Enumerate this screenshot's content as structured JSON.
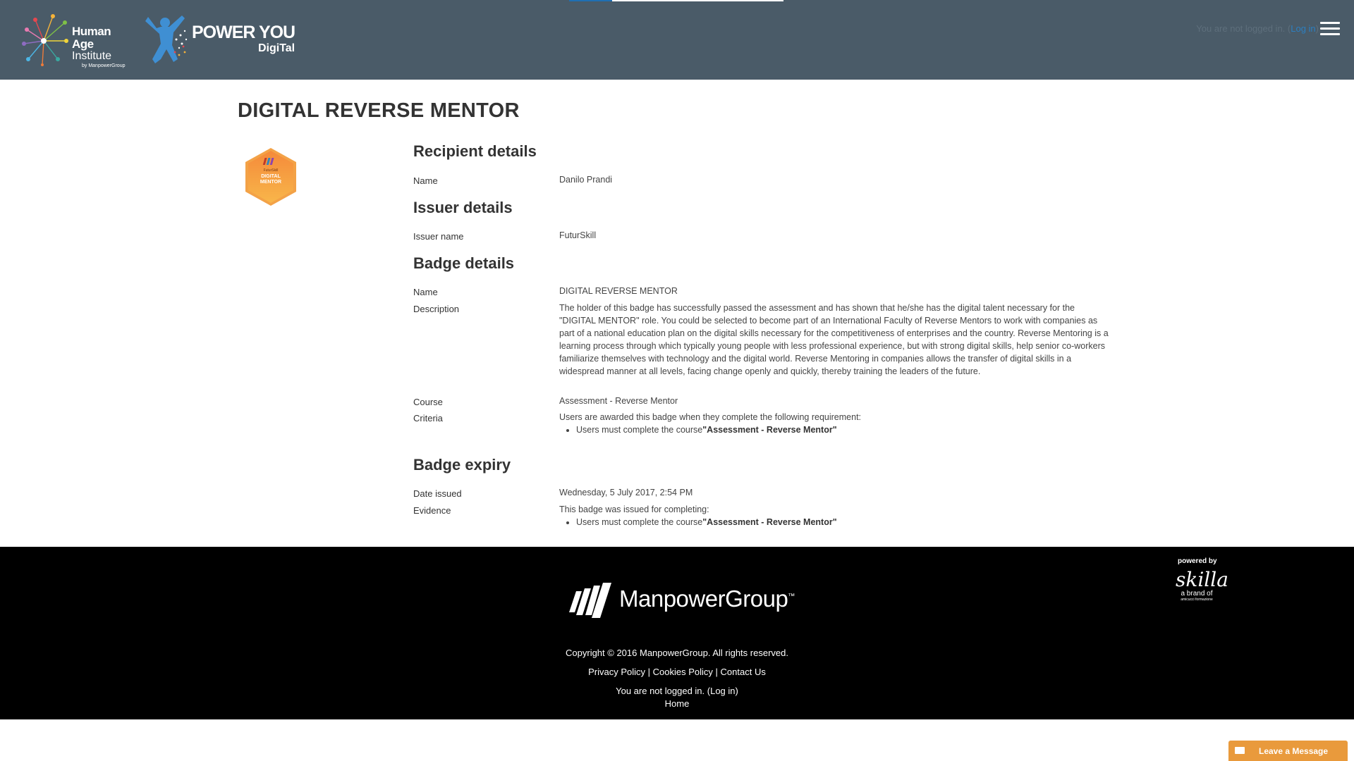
{
  "header": {
    "logo_hai": {
      "line1": "Human Age",
      "line2": "Institute",
      "line3": "by ManpowerGroup"
    },
    "logo_py": {
      "line1": "POWER YOU",
      "line2": "DigiTal"
    },
    "login_status_prefix": "You are not logged in. (",
    "login_link": "Log in",
    "login_status_suffix": ")",
    "top_progress_percent": 20
  },
  "page": {
    "title": "DIGITAL REVERSE MENTOR"
  },
  "badge_image": {
    "line1": "FuturSkill",
    "line2": "DIGITAL",
    "line3": "MENTOR"
  },
  "recipient": {
    "heading": "Recipient details",
    "name_label": "Name",
    "name_value": "Danilo Prandi"
  },
  "issuer": {
    "heading": "Issuer details",
    "name_label": "Issuer name",
    "name_value": "FuturSkill"
  },
  "badge": {
    "heading": "Badge details",
    "name_label": "Name",
    "name_value": "DIGITAL REVERSE MENTOR",
    "description_label": "Description",
    "description_value": "The holder of this badge has successfully passed the assessment and has shown that he/she has the digital talent necessary for the \"DIGITAL MENTOR\" role. You could be selected to become part of an International Faculty of Reverse Mentors to work with companies as part of a national education plan on the digital skills necessary for the competitiveness of enterprises and the country. Reverse Mentoring is a learning process through which typically young people with less professional experience, but with strong digital skills, help senior co-workers familiarize themselves with technology and the digital world. Reverse Mentoring in companies allows the transfer of digital skills in a widespread manner at all levels, facing change openly and quickly, thereby training the leaders of the future.",
    "course_label": "Course",
    "course_value": "Assessment - Reverse Mentor",
    "criteria_label": "Criteria",
    "criteria_intro": "Users are awarded this badge when they complete the following requirement:",
    "criteria_item_prefix": "Users must complete the course",
    "criteria_item_course": "\"Assessment - Reverse Mentor\""
  },
  "expiry": {
    "heading": "Badge expiry",
    "date_label": "Date issued",
    "date_value": "Wednesday, 5 July 2017, 2:54 PM",
    "evidence_label": "Evidence",
    "evidence_intro": "This badge was issued for completing:",
    "evidence_item_prefix": "Users must complete the course",
    "evidence_item_course": "\"Assessment - Reverse Mentor\""
  },
  "footer": {
    "brand": "ManpowerGroup",
    "trademark": "™",
    "powered_by": "powered by",
    "skilla_name": "skilla",
    "skilla_sub": "a brand of",
    "skilla_sub2": "amicucci formazione",
    "copyright": "Copyright © 2016 ManpowerGroup. All rights reserved.",
    "privacy": "Privacy Policy",
    "cookies": "Cookies Policy",
    "contact": "Contact Us",
    "separator": " | ",
    "login_prefix": "You are not logged in. (",
    "login_link": "Log in",
    "login_suffix": ")",
    "home": "Home"
  },
  "leave_message": {
    "label": "Leave a Message"
  },
  "colors": {
    "header_bg": "#4a5b68",
    "footer_bg": "#000000",
    "link": "#2c7fc0",
    "badge_orange": "#f5a04a",
    "leave_message_bg": "#e99a3c"
  }
}
